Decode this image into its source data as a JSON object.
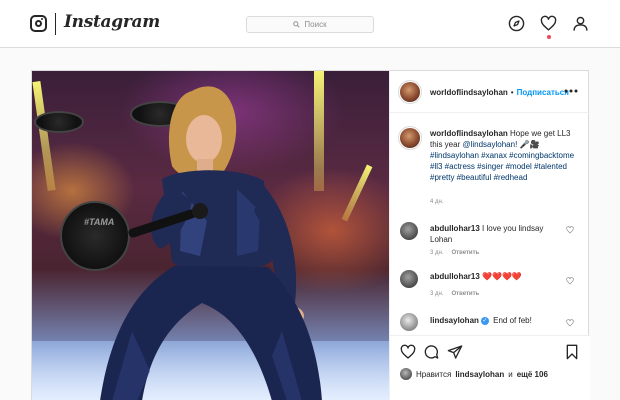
{
  "header": {
    "logo_text": "Instagram",
    "search_placeholder": "Поиск"
  },
  "post": {
    "author": "worldoflindsaylohan",
    "follow_label": "Подписаться",
    "caption": {
      "username": "worldoflindsaylohan",
      "text": " Hope we get LL3 this year ",
      "mention": "@lindsaylohan!",
      "emoji": " 🎤🎥",
      "hashtags": "#lindsaylohan #xanax #comingbacktome #ll3 #actress #singer #model #talented #pretty #beautiful #redhead",
      "time": "4 дн."
    },
    "comments": [
      {
        "username": "abdullohar13",
        "text": "I love you lindsay Lohan",
        "time": "3 дн.",
        "reply": "Ответить"
      },
      {
        "username": "abdullohar13",
        "text": "❤️❤️❤️❤️",
        "time": "3 дн.",
        "reply": "Ответить"
      },
      {
        "username": "lindsaylohan",
        "verified": "✓",
        "text": "End of feb!"
      }
    ],
    "likes": {
      "prefix": "Нравится",
      "user": "lindsaylohan",
      "middle": "и",
      "count": "ещё 106"
    },
    "drum_text": "#TAMA"
  }
}
